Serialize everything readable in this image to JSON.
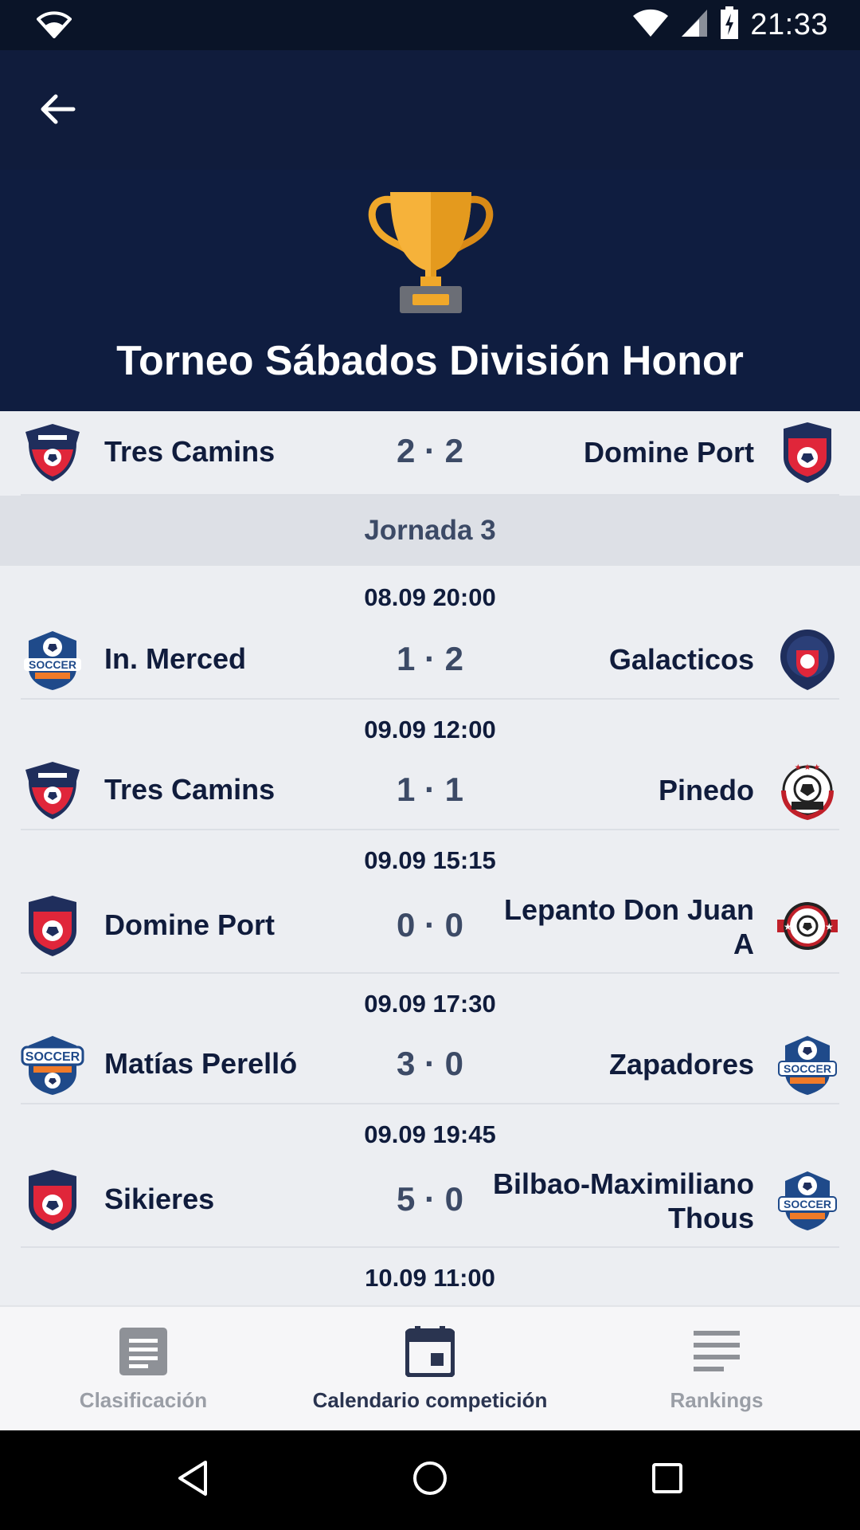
{
  "status_bar": {
    "time": "21:33"
  },
  "header": {
    "title": "Torneo Sábados División Honor"
  },
  "first_match": {
    "home": "Tres Camins",
    "score": "2 · 2",
    "away": "Domine Port"
  },
  "round": {
    "label": "Jornada 3"
  },
  "matches": [
    {
      "date": "08.09 20:00",
      "home": "In. Merced",
      "score": "1 · 2",
      "away": "Galacticos"
    },
    {
      "date": "09.09 12:00",
      "home": "Tres Camins",
      "score": "1 · 1",
      "away": "Pinedo"
    },
    {
      "date": "09.09 15:15",
      "home": "Domine Port",
      "score": "0 · 0",
      "away": "Lepanto Don Juan A"
    },
    {
      "date": "09.09 17:30",
      "home": "Matías Perelló",
      "score": "3 · 0",
      "away": "Zapadores"
    },
    {
      "date": "09.09 19:45",
      "home": "Sikieres",
      "score": "5 · 0",
      "away": "Bilbao-Maximiliano Thous"
    },
    {
      "date": "10.09 11:00"
    }
  ],
  "bottom_nav": {
    "items": [
      {
        "label": "Clasificación",
        "icon": "document-icon",
        "active": false
      },
      {
        "label": "Calendario competición",
        "icon": "calendar-icon",
        "active": true
      },
      {
        "label": "Rankings",
        "icon": "list-icon",
        "active": false
      }
    ]
  },
  "colors": {
    "app_bar": "#101c3c",
    "header": "#0f1d40",
    "accent_gold": "#f0a82a",
    "text_dark": "#101c3c"
  }
}
